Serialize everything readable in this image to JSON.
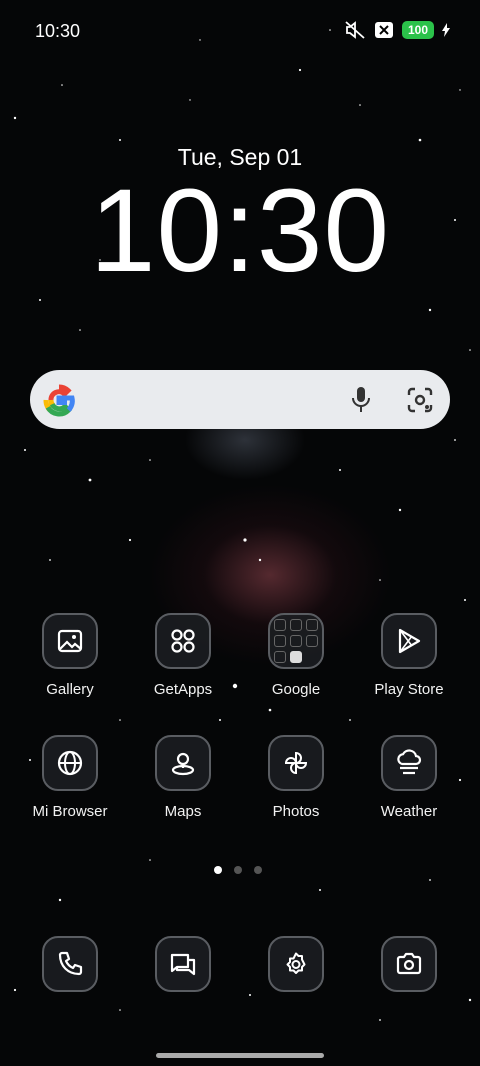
{
  "status_bar": {
    "time": "10:30",
    "battery": "100",
    "icons": [
      "mute-icon",
      "close-notification-icon",
      "battery-icon",
      "charging-icon"
    ]
  },
  "lock": {
    "date": "Tue, Sep 01",
    "clock": "10:30"
  },
  "search": {
    "icons": [
      "google-logo-icon",
      "mic-icon",
      "lens-icon"
    ]
  },
  "apps_row1": [
    {
      "label": "Gallery",
      "icon": "gallery-icon"
    },
    {
      "label": "GetApps",
      "icon": "getapps-icon"
    },
    {
      "label": "Google",
      "icon": "google-folder-icon"
    },
    {
      "label": "Play Store",
      "icon": "play-store-icon"
    }
  ],
  "apps_row2": [
    {
      "label": "Mi Browser",
      "icon": "browser-icon"
    },
    {
      "label": "Maps",
      "icon": "maps-icon"
    },
    {
      "label": "Photos",
      "icon": "photos-icon"
    },
    {
      "label": "Weather",
      "icon": "weather-icon"
    }
  ],
  "dock": [
    {
      "icon": "phone-icon"
    },
    {
      "icon": "messages-icon"
    },
    {
      "icon": "settings-icon"
    },
    {
      "icon": "camera-icon"
    }
  ],
  "pages": {
    "count": 3,
    "active": 1
  },
  "colors": {
    "battery": "#2bc24a",
    "search_bg": "#e9ebee",
    "tile_border": "#5a5d62"
  }
}
